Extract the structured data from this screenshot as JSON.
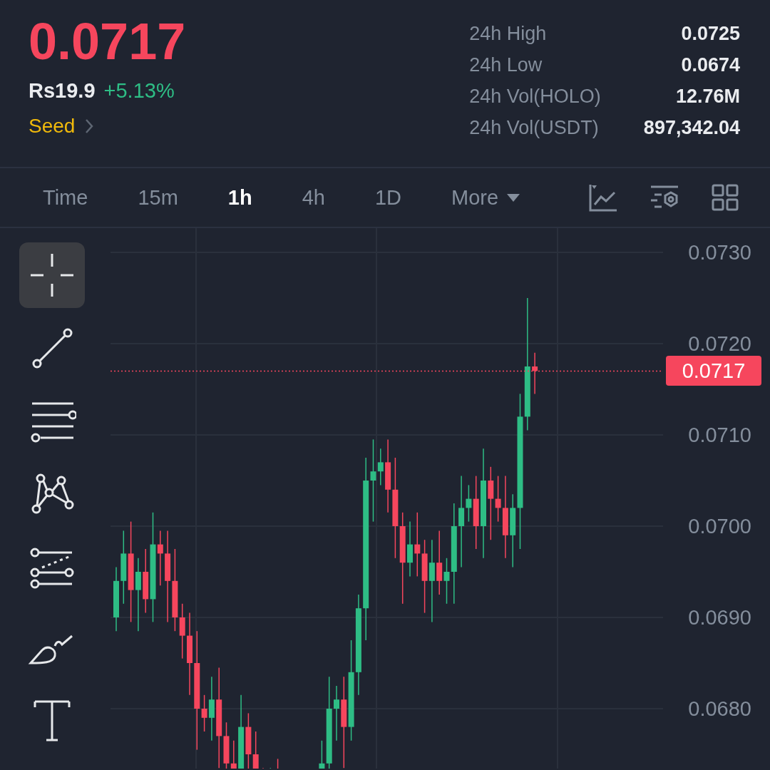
{
  "price": {
    "last": "0.0717",
    "fiat": "Rs19.9",
    "change": "+5.13%",
    "tag": "Seed"
  },
  "stats": [
    {
      "label": "24h High",
      "value": "0.0725"
    },
    {
      "label": "24h Low",
      "value": "0.0674"
    },
    {
      "label": "24h Vol(HOLO)",
      "value": "12.76M"
    },
    {
      "label": "24h Vol(USDT)",
      "value": "897,342.04"
    }
  ],
  "intervals": [
    {
      "label": "Time",
      "kind": "interval",
      "selected": false
    },
    {
      "label": "15m",
      "kind": "interval",
      "selected": false
    },
    {
      "label": "1h",
      "kind": "interval",
      "selected": true
    },
    {
      "label": "4h",
      "kind": "interval",
      "selected": false
    },
    {
      "label": "1D",
      "kind": "interval",
      "selected": false
    },
    {
      "label": "More",
      "kind": "menu",
      "selected": false
    }
  ],
  "drawing_tools": [
    {
      "kind": "crosshair",
      "selected": true
    },
    {
      "kind": "trendline",
      "selected": false
    },
    {
      "kind": "parallel",
      "selected": false
    },
    {
      "kind": "pattern",
      "selected": false
    },
    {
      "kind": "fib",
      "selected": false
    },
    {
      "kind": "brush",
      "selected": false
    },
    {
      "kind": "text",
      "selected": false
    }
  ],
  "chart": {
    "y_axis": [
      "0.0730",
      "0.0720",
      "0.0710",
      "0.0700",
      "0.0690",
      "0.0680"
    ],
    "last_price": "0.0717"
  }
}
